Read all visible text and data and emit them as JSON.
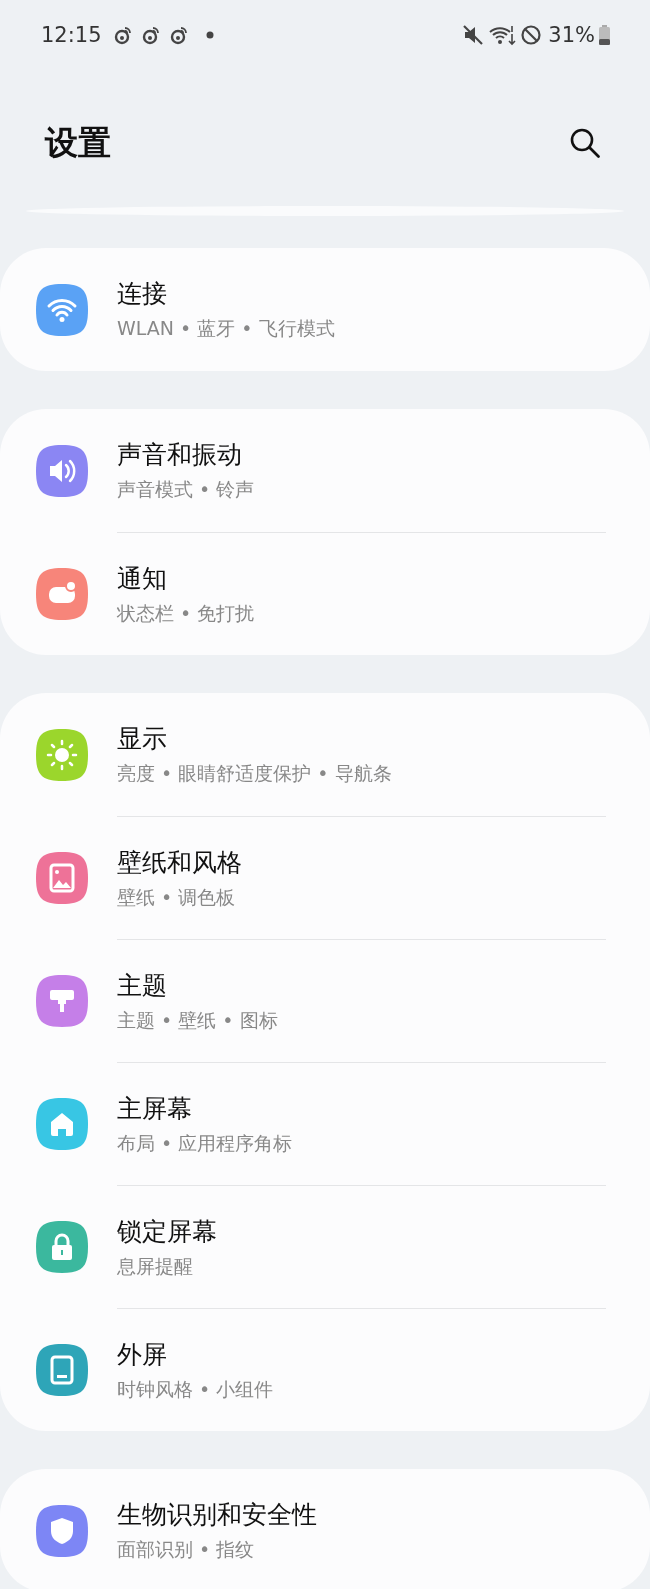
{
  "status_bar": {
    "time": "12:15",
    "battery": "31%"
  },
  "header": {
    "title": "设置"
  },
  "sections": [
    {
      "items": [
        {
          "kind": "wifi",
          "color": "#5aa2f5",
          "title": "连接",
          "subtitle": "WLAN • 蓝牙 • 飞行模式"
        }
      ]
    },
    {
      "items": [
        {
          "kind": "sound",
          "color": "#8b86f3",
          "title": "声音和振动",
          "subtitle": "声音模式 • 铃声"
        },
        {
          "kind": "notification",
          "color": "#f7857a",
          "title": "通知",
          "subtitle": "状态栏 • 免打扰"
        }
      ]
    },
    {
      "items": [
        {
          "kind": "sun",
          "color": "#9bd62c",
          "title": "显示",
          "subtitle": "亮度 • 眼睛舒适度保护 • 导航条"
        },
        {
          "kind": "image",
          "color": "#ee7298",
          "title": "壁纸和风格",
          "subtitle": "壁纸 • 调色板"
        },
        {
          "kind": "brush",
          "color": "#c57fe8",
          "title": "主题",
          "subtitle": "主题 • 壁纸 • 图标"
        },
        {
          "kind": "home",
          "color": "#38c6e4",
          "title": "主屏幕",
          "subtitle": "布局 • 应用程序角标"
        },
        {
          "kind": "lock",
          "color": "#3bb89e",
          "title": "锁定屏幕",
          "subtitle": "息屏提醒"
        },
        {
          "kind": "screen",
          "color": "#2ea5b8",
          "title": "外屏",
          "subtitle": "时钟风格 • 小组件"
        }
      ]
    },
    {
      "items": [
        {
          "kind": "shield",
          "color": "#7d86f5",
          "title": "生物识别和安全性",
          "subtitle": "面部识别 • 指纹"
        }
      ]
    }
  ]
}
